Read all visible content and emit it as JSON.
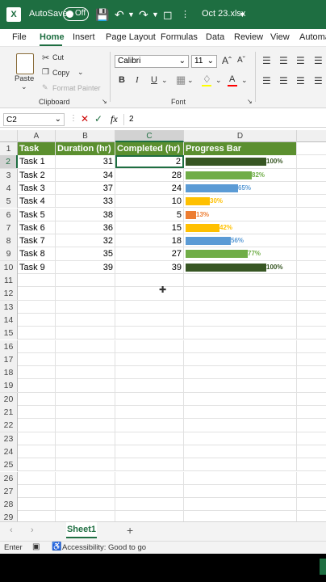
{
  "titlebar": {
    "autosave_label": "AutoSave",
    "toggle_state": "Off",
    "filename": "Oct 23.xlsx"
  },
  "menu": {
    "tabs": [
      "File",
      "Home",
      "Insert",
      "Page Layout",
      "Formulas",
      "Data",
      "Review",
      "View",
      "Automa"
    ]
  },
  "ribbon": {
    "paste_label": "Paste",
    "cut_label": "Cut",
    "copy_label": "Copy",
    "format_painter_label": "Format Painter",
    "clipboard_label": "Clipboard",
    "font_name": "Calibri",
    "font_size": "11",
    "font_label": "Font"
  },
  "formula_bar": {
    "cell_ref": "C2",
    "fx": "fx",
    "value": "2"
  },
  "columns": [
    "A",
    "B",
    "C",
    "D"
  ],
  "headers": [
    "Task",
    "Duration (hr)",
    "Completed (hr)",
    "Progress Bar"
  ],
  "rows": [
    {
      "task": "Task 1",
      "duration": "31",
      "completed": "2",
      "pct": "100%",
      "fill": 1.0,
      "color": "#375623"
    },
    {
      "task": "Task 2",
      "duration": "34",
      "completed": "28",
      "pct": "82%",
      "fill": 0.82,
      "color": "#70ad47"
    },
    {
      "task": "Task 3",
      "duration": "37",
      "completed": "24",
      "pct": "65%",
      "fill": 0.65,
      "color": "#5b9bd5"
    },
    {
      "task": "Task 4",
      "duration": "33",
      "completed": "10",
      "pct": "30%",
      "fill": 0.3,
      "color": "#ffc000"
    },
    {
      "task": "Task 5",
      "duration": "38",
      "completed": "5",
      "pct": "13%",
      "fill": 0.13,
      "color": "#ed7d31"
    },
    {
      "task": "Task 6",
      "duration": "36",
      "completed": "15",
      "pct": "42%",
      "fill": 0.42,
      "color": "#ffc000"
    },
    {
      "task": "Task 7",
      "duration": "32",
      "completed": "18",
      "pct": "56%",
      "fill": 0.56,
      "color": "#5b9bd5"
    },
    {
      "task": "Task 8",
      "duration": "35",
      "completed": "27",
      "pct": "77%",
      "fill": 0.77,
      "color": "#70ad47"
    },
    {
      "task": "Task 9",
      "duration": "39",
      "completed": "39",
      "pct": "100%",
      "fill": 1.0,
      "color": "#375623"
    }
  ],
  "row_numbers": [
    "1",
    "2",
    "3",
    "4",
    "5",
    "6",
    "7",
    "8",
    "9",
    "10",
    "11",
    "12",
    "13",
    "14",
    "15",
    "16",
    "17",
    "18",
    "19",
    "20",
    "21",
    "22",
    "23",
    "24",
    "25",
    "26",
    "27",
    "28",
    "29"
  ],
  "sheet_tab": "Sheet1",
  "status": {
    "mode": "Enter",
    "accessibility": "Accessibility: Good to go"
  }
}
